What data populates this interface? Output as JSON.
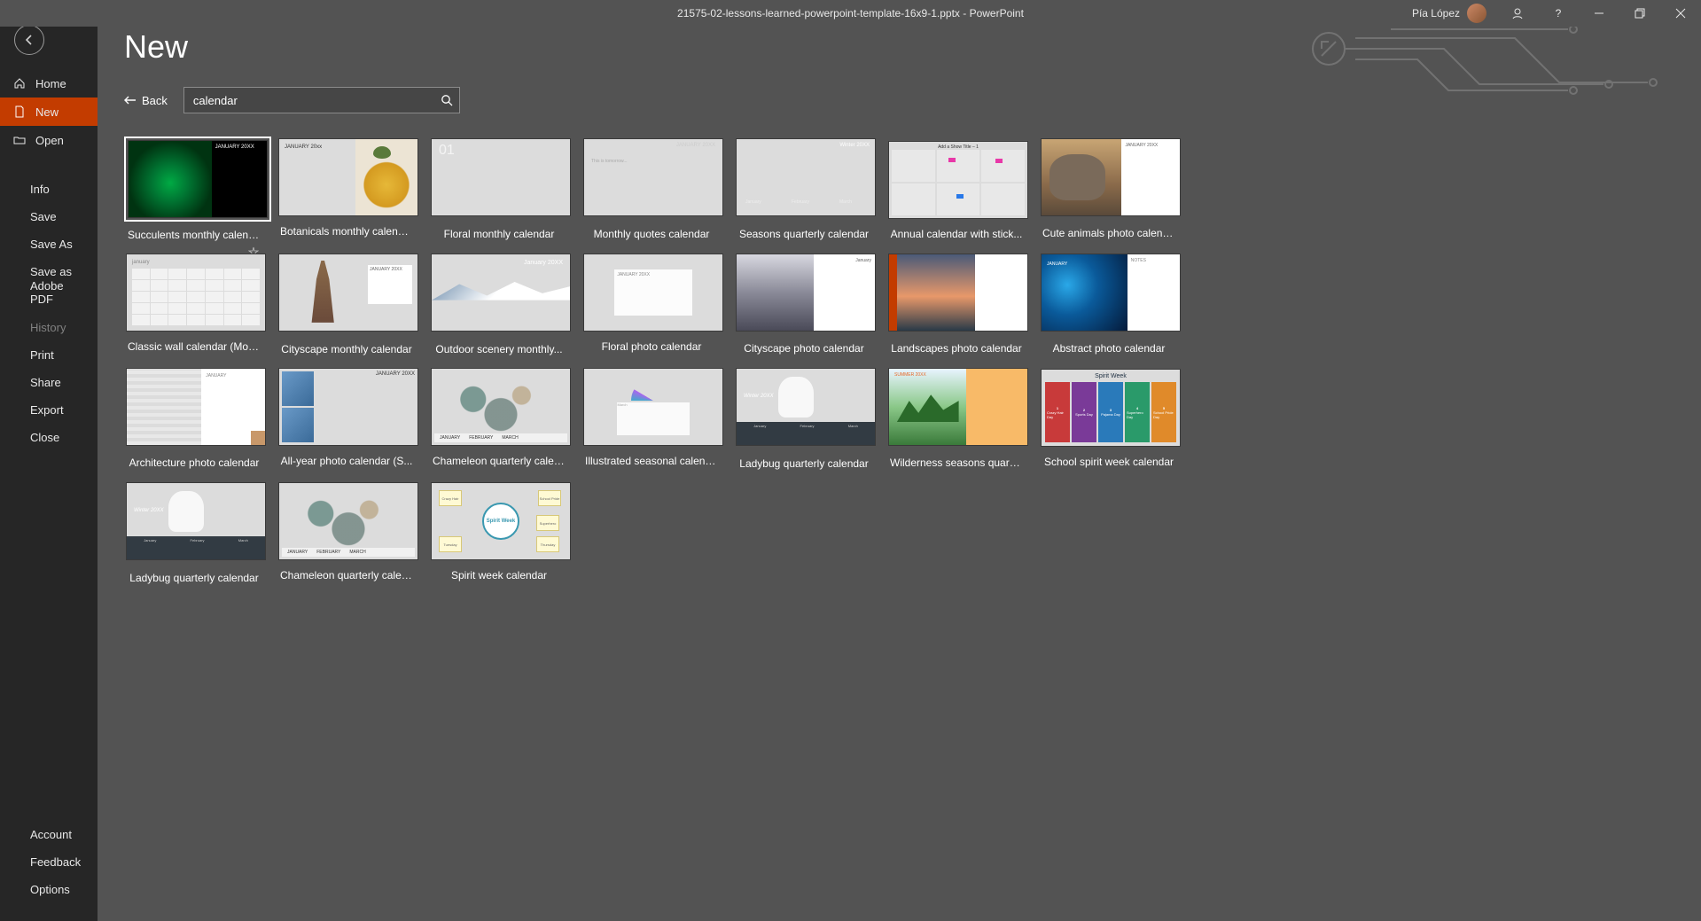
{
  "titlebar": {
    "doc_title": "21575-02-lessons-learned-powerpoint-template-16x9-1.pptx  -  PowerPoint",
    "user_name": "Pía López"
  },
  "nav": {
    "home": "Home",
    "new": "New",
    "open": "Open",
    "info": "Info",
    "save": "Save",
    "save_as": "Save As",
    "save_adobe": "Save as Adobe PDF",
    "history": "History",
    "print": "Print",
    "share": "Share",
    "export": "Export",
    "close": "Close",
    "account": "Account",
    "feedback": "Feedback",
    "options": "Options"
  },
  "main": {
    "page_title": "New",
    "back_label": "Back",
    "search_value": "calendar"
  },
  "templates": [
    {
      "label": "Succulents monthly calendar",
      "selected": true
    },
    {
      "label": "Botanicals monthly calendar"
    },
    {
      "label": "Floral monthly calendar"
    },
    {
      "label": "Monthly quotes calendar"
    },
    {
      "label": "Seasons quarterly calendar"
    },
    {
      "label": "Annual calendar with stick..."
    },
    {
      "label": "Cute animals photo calendar"
    },
    {
      "label": "Classic wall calendar (Mon-..."
    },
    {
      "label": "Cityscape monthly calendar"
    },
    {
      "label": "Outdoor scenery monthly..."
    },
    {
      "label": "Floral photo calendar"
    },
    {
      "label": "Cityscape photo calendar"
    },
    {
      "label": "Landscapes photo calendar"
    },
    {
      "label": "Abstract photo calendar"
    },
    {
      "label": "Architecture photo calendar"
    },
    {
      "label": "All-year photo calendar (S..."
    },
    {
      "label": "Chameleon quarterly calen..."
    },
    {
      "label": "Illustrated seasonal calenda..."
    },
    {
      "label": "Ladybug quarterly calendar"
    },
    {
      "label": "Wilderness seasons quarter..."
    },
    {
      "label": "School spirit week calendar"
    },
    {
      "label": "Ladybug quarterly calendar"
    },
    {
      "label": "Chameleon quarterly calen..."
    },
    {
      "label": "Spirit week calendar"
    }
  ],
  "thumb_text": {
    "succ_month": "JANUARY 20XX",
    "bot_month": "JANUARY 20xx",
    "quotes_month": "JANUARY 20XX",
    "seasons_label": "Winter 20XX",
    "seasons_m1": "January",
    "seasons_m2": "February",
    "seasons_m3": "March",
    "annual_title": "Add a Show Title – 1",
    "eleph_month": "JANUARY 20XX",
    "classic_month": "january",
    "cityart_month": "JANUARY 20XX",
    "outdoor_month": "January 20XX",
    "floralp_month": "JANUARY 20XX",
    "cityp_month": "January",
    "arch_month": "JANUARY",
    "allyear_month": "JANUARY 20XX",
    "cham_m1": "JANUARY",
    "cham_m2": "FEBRUARY",
    "cham_m3": "MARCH",
    "illus_month": "March",
    "lady_label": "Winter 20XX",
    "lady_m1": "January",
    "lady_m2": "February",
    "lady_m3": "March",
    "abstract_notes": "NOTES",
    "spirit_title": "Spirit Week",
    "spirit_center": "Spirit Week",
    "school_days": [
      {
        "n": "1",
        "d": "Crazy Hair Day",
        "c": "#c83a3a"
      },
      {
        "n": "2",
        "d": "Sports Day",
        "c": "#7a3a98"
      },
      {
        "n": "3",
        "d": "Pajama Day",
        "c": "#2a7aba"
      },
      {
        "n": "4",
        "d": "Superhero Day",
        "c": "#2a9a6a"
      },
      {
        "n": "5",
        "d": "School Pride Day",
        "c": "#e08a2a"
      }
    ]
  }
}
